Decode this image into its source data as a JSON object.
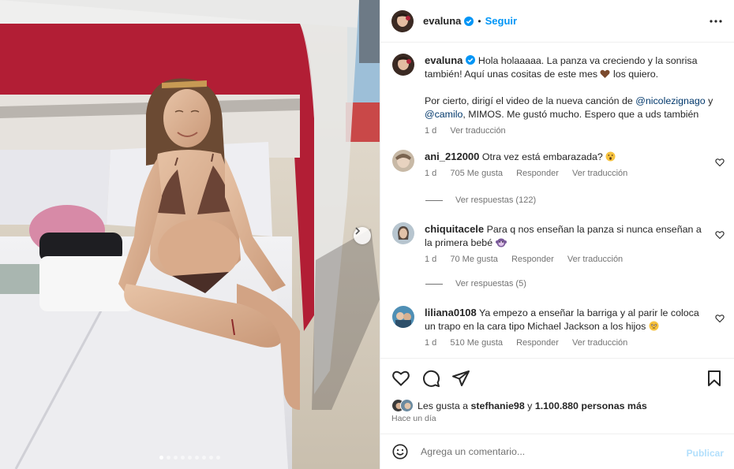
{
  "post": {
    "username": "evaluna",
    "follow_label": "Seguir",
    "separator": "•",
    "more_icon": "more-horizontal-icon"
  },
  "caption": {
    "username": "evaluna",
    "text_1": "Hola holaaaaa. La panza va creciendo y la sonrisa también! Aquí unas cositas de este mes",
    "text_1b": "los quiero.",
    "text_2a": "Por cierto, dirigí el video de la nueva canción de",
    "mention_1": "@nicolezignago",
    "text_2b": "y",
    "mention_2": "@camilo",
    "text_2c": ", MIMOS. Me gustó mucho. Espero que a uds también",
    "time": "1 d",
    "translate": "Ver traducción"
  },
  "comments": [
    {
      "username": "ani_212000",
      "text": "Otra vez está embarazada?",
      "time": "1 d",
      "likes": "705 Me gusta",
      "reply": "Responder",
      "translate": "Ver traducción",
      "replies": "Ver respuestas (122)"
    },
    {
      "username": "chiquitacele",
      "text": "Para q nos enseñan la panza si nunca enseñan a la primera bebé",
      "time": "1 d",
      "likes": "70 Me gusta",
      "reply": "Responder",
      "translate": "Ver traducción",
      "replies": "Ver respuestas (5)"
    },
    {
      "username": "liliana0108",
      "text": "Ya empezo a enseñar la barriga y al parir le coloca un trapo en la cara tipo Michael Jackson a los hijos",
      "time": "1 d",
      "likes": "510 Me gusta",
      "reply": "Responder",
      "translate": "Ver traducción"
    }
  ],
  "likes": {
    "prefix": "Les gusta a",
    "user": "stefhanie98",
    "middle": "y",
    "count": "1.100.880 personas más"
  },
  "time_ago": "Hace un día",
  "add_comment": {
    "placeholder": "Agrega un comentario...",
    "publish": "Publicar"
  },
  "carousel": {
    "current": 1,
    "total": 9
  },
  "colors": {
    "accent": "#0095f6",
    "publish_disabled": "#b2dffc",
    "muted": "#737373",
    "mention": "#00376b"
  }
}
